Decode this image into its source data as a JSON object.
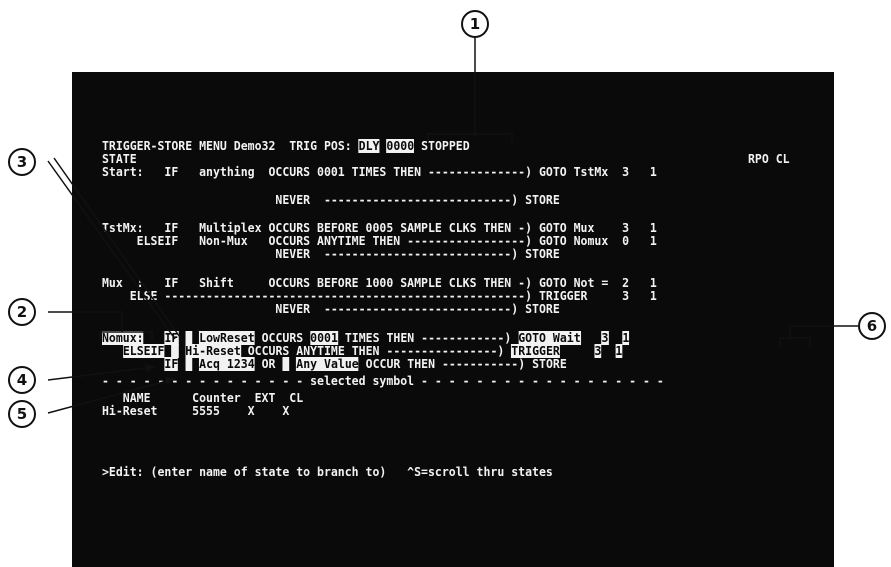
{
  "header": {
    "title": "TRIGGER-STORE MENU",
    "program": "Demo32",
    "trig_pos_label": "TRIG POS:",
    "trig_pos_mode": "DLY",
    "trig_pos_value": "0000",
    "status": "STOPPED"
  },
  "columns": {
    "state": "STATE",
    "rpo_cl": "RPO CL"
  },
  "states": {
    "start": {
      "row1": "Start:   IF   anything  OCCURS 0001 TIMES THEN --------------) GOTO TstMx  3   1",
      "never": "                         NEVER  ---------------------------) STORE"
    },
    "tstmx": {
      "row1": "TstMx:   IF   Multiplex OCCURS BEFORE 0005 SAMPLE CLKS THEN -) GOTO Mux    3   1",
      "row2": "     ELSEIF   Non-Mux   OCCURS ANYTIME THEN -----------------) GOTO Nomux  0   1",
      "never": "                         NEVER  ---------------------------) STORE"
    },
    "mux": {
      "row1": "Mux  :   IF   Shift     OCCURS BEFORE 1000 SAMPLE CLKS THEN -) GOTO Not =  2   1",
      "else": "    ELSE ----------------------------------------------------) TRIGGER     3   1",
      "never": "                         NEVER  ---------------------------) STORE"
    },
    "nomux": {
      "label": "Nomux:",
      "if_kw": "IF",
      "cond1": "LowReset",
      "occurs_prefix": "OCCURS",
      "count": "0001",
      "occurs_suffix": "TIMES THEN ------------)",
      "action1": "GOTO Wait",
      "rpo1": "3",
      "cl1": "1",
      "elseif_kw": "ELSEIF",
      "cond2": "Hi-Reset",
      "occurs2": "OCCURS ANYTIME THEN ----------------)",
      "action2": "TRIGGER",
      "rpo2": "3",
      "cl2": "1",
      "cond3": "Acq 1234",
      "or_kw": "OR",
      "cond4": "Any Value",
      "occur3": "OCCUR THEN -----------)",
      "action3": "STORE"
    }
  },
  "symbol_panel": {
    "divider": "- - - - - - - - - - - - - - - selected symbol - - - - - - - - - - - - - - - - - -",
    "headers": "   NAME      Counter  EXT  CL",
    "row": "Hi-Reset     5555    X    X"
  },
  "prompt": {
    "text": ">Edit: (enter name of state to branch to)   ^S=scroll thru states"
  },
  "callouts": [
    "1",
    "2",
    "3",
    "4",
    "5",
    "6"
  ]
}
